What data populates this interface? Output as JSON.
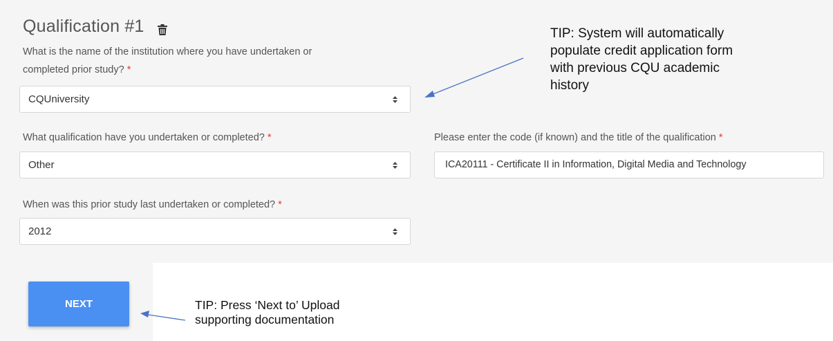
{
  "qualification": {
    "title": "Qualification #1",
    "delete_icon": "trash-icon"
  },
  "institution": {
    "label_line1": "What is the name of the institution where you have undertaken or",
    "label_line2": "completed prior study?",
    "required_mark": "*",
    "value": "CQUniversity"
  },
  "qualification_type": {
    "label": "What qualification have you undertaken or completed?",
    "required_mark": "*",
    "value": "Other"
  },
  "qualification_code": {
    "label": "Please enter the code (if known) and the title of the qualification",
    "required_mark": "*",
    "value": "ICA20111 - Certificate II in Information, Digital Media and Technology"
  },
  "last_completed": {
    "label": "When was this prior study last undertaken or completed?",
    "required_mark": "*",
    "value": "2012"
  },
  "next_button": {
    "label": "NEXT"
  },
  "tips": {
    "tip1_lines": [
      "TIP: System will automatically",
      "populate credit application form",
      "with previous CQU academic",
      "history"
    ],
    "tip2_lines": [
      "TIP: Press ‘Next to’ Upload",
      "supporting documentation"
    ]
  },
  "colors": {
    "accent": "#4a90f2",
    "required": "#e53935",
    "arrow": "#4a74c4"
  }
}
